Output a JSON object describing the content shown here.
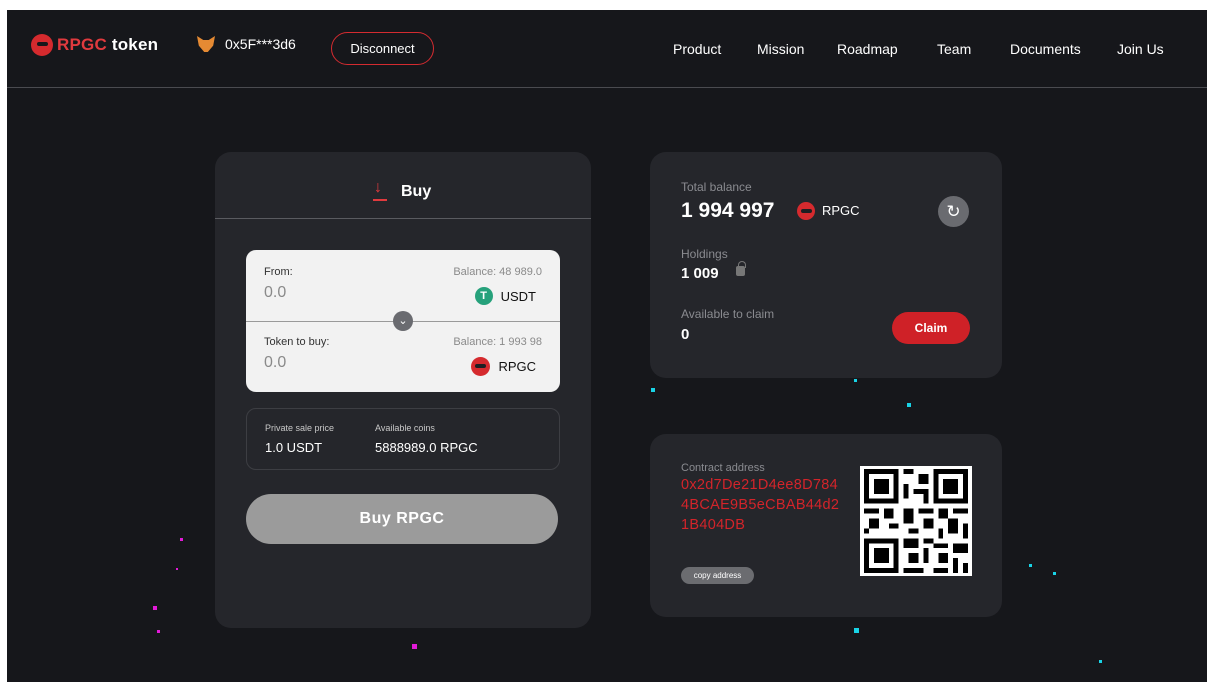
{
  "header": {
    "logo_brand": "RPGC",
    "logo_suffix": "token",
    "wallet_address": "0x5F***3d6",
    "disconnect_label": "Disconnect",
    "nav": [
      "Product",
      "Mission",
      "Roadmap",
      "Team",
      "Documents",
      "Join Us"
    ]
  },
  "buy": {
    "title": "Buy",
    "from_label": "From:",
    "from_balance": "Balance: 48 989.0",
    "from_placeholder": "0.0",
    "from_token": "USDT",
    "to_label": "Token to buy:",
    "to_balance": "Balance: 1 993 98",
    "to_placeholder": "0.0",
    "to_token": "RPGC",
    "private_sale_label": "Private sale price",
    "private_sale_value": "1.0 USDT",
    "available_coins_label": "Available coins",
    "available_coins_value": "5888989.0 RPGC",
    "buy_button": "Buy RPGC"
  },
  "balance": {
    "total_label": "Total balance",
    "total_value": "1 994 997",
    "token": "RPGC",
    "holdings_label": "Holdings",
    "holdings_value": "1 009",
    "available_label": "Available to claim",
    "available_value": "0",
    "claim_label": "Claim"
  },
  "contract": {
    "label": "Contract address",
    "address": "0x2d7De21D4ee8D7844BCAE9B5eCBAB44d21B404DB",
    "copy_label": "copy address"
  },
  "icons": {
    "usdt_glyph": "T",
    "refresh_glyph": "↻",
    "swap_glyph": "⌄"
  },
  "colors": {
    "background": "#16171b",
    "card": "#25262b",
    "accent_red": "#cf2127",
    "particle_cyan": "#19d3e6",
    "particle_magenta": "#e21ad8"
  }
}
